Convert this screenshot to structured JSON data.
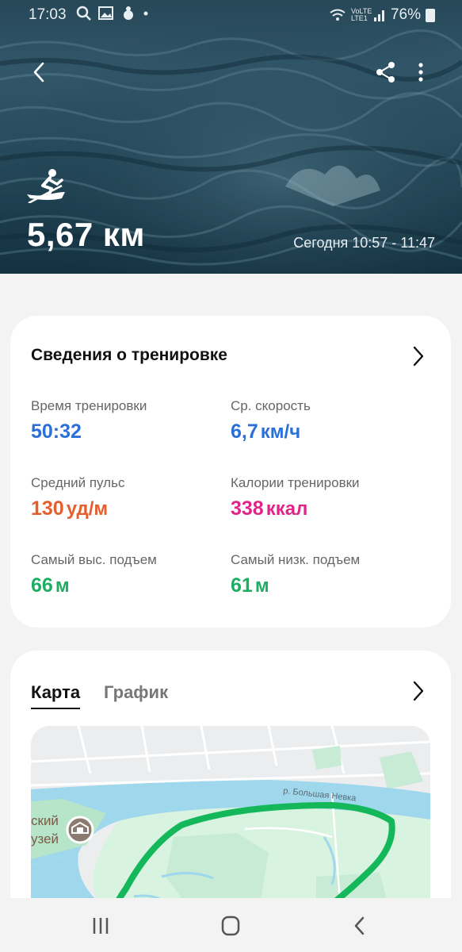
{
  "status_bar": {
    "time": "17:03",
    "battery": "76%",
    "network": "VoLTE LTE1"
  },
  "header": {
    "sport_icon": "rowing-icon",
    "distance": "5,67 км",
    "date_range": "Сегодня 10:57 - 11:47"
  },
  "workout_card": {
    "title": "Сведения о тренировке",
    "stats": [
      {
        "label": "Время тренировки",
        "value": "50:32",
        "unit": "",
        "color": "#2b70d8"
      },
      {
        "label": "Ср. скорость",
        "value": "6,7",
        "unit": "км/ч",
        "color": "#2b70d8"
      },
      {
        "label": "Средний пульс",
        "value": "130",
        "unit": "уд/м",
        "color": "#e55f2e"
      },
      {
        "label": "Калории тренировки",
        "value": "338",
        "unit": "ккал",
        "color": "#e0258a"
      },
      {
        "label": "Самый выс. подъем",
        "value": "66",
        "unit": "м",
        "color": "#1eae62"
      },
      {
        "label": "Самый низк. подъем",
        "value": "61",
        "unit": "м",
        "color": "#1eae62"
      }
    ]
  },
  "map_card": {
    "tabs": [
      "Карта",
      "График"
    ],
    "active_tab": "Карта",
    "map_labels": {
      "river": "р. Большая Невка",
      "museum_line1": "ский",
      "museum_line2": "узей"
    },
    "route_color": "#14b85a"
  },
  "nav_bar": {
    "icons": [
      "recent-apps-icon",
      "home-icon",
      "back-icon"
    ]
  }
}
